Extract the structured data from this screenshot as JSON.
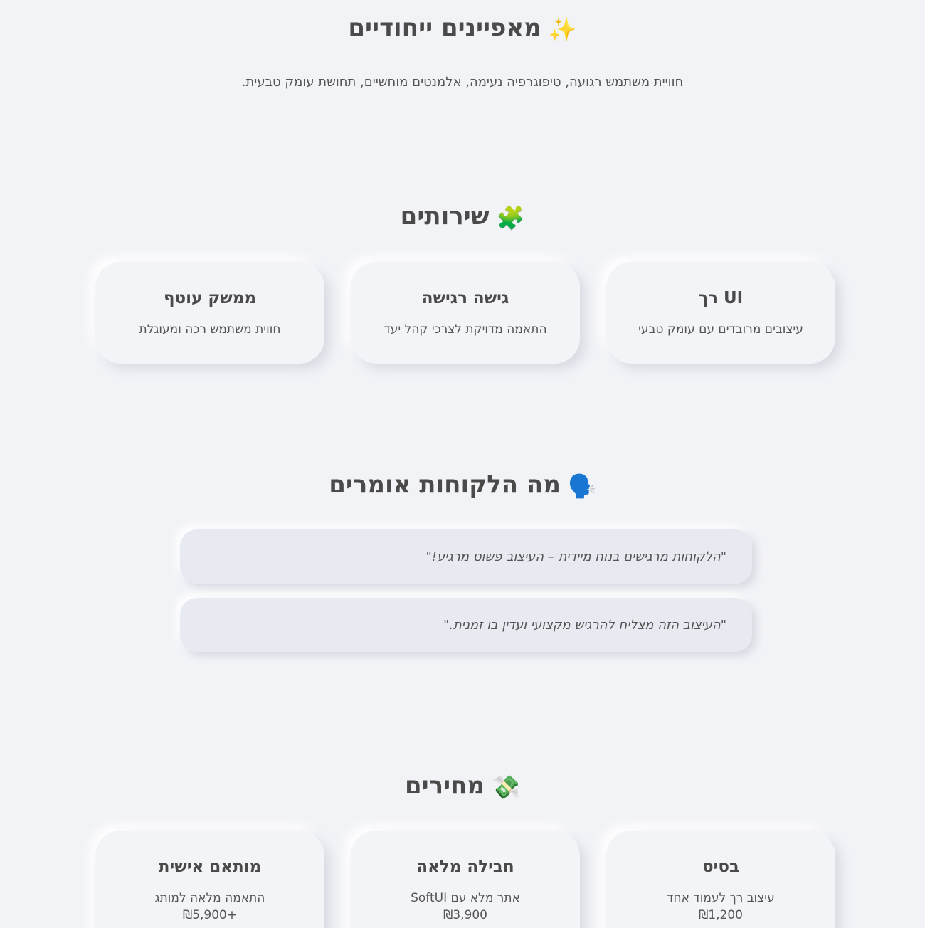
{
  "hero": {
    "emoji": "✨",
    "title": "מאפיינים ייחודיים",
    "subtitle": "חוויית משתמש רגועה, טיפוגרפיה נעימה, אלמנטים מוחשיים, תחושת עומק טבעית."
  },
  "services": {
    "emoji": "🧩",
    "title": "שירותים",
    "items": [
      {
        "title": "UI רך",
        "desc": "עיצובים מרובדים עם עומק טבעי"
      },
      {
        "title": "גישה רגישה",
        "desc": "התאמה מדויקת לצרכי קהל יעד"
      },
      {
        "title": "ממשק עוטף",
        "desc": "חווית משתמש רכה ומעוגלת"
      }
    ]
  },
  "testimonials": {
    "emoji": "🗣️",
    "title": "מה הלקוחות אומרים",
    "quotes": [
      "\"הלקוחות מרגישים בנוח מיידית – העיצוב פשוט מרגיע!\"",
      "\"העיצוב הזה מצליח להרגיש מקצועי ועדין בו זמנית.\""
    ]
  },
  "pricing": {
    "emoji": "💸",
    "title": "מחירים",
    "plans": [
      {
        "title": "בסיס",
        "desc": "עיצוב רך לעמוד אחד",
        "price": "₪1,200"
      },
      {
        "title": "חבילה מלאה",
        "desc": "אתר מלא עם SoftUI",
        "price": "₪3,900"
      },
      {
        "title": "מותאם אישית",
        "desc": "התאמה מלאה למותג",
        "price": "₪5,900+"
      }
    ]
  }
}
